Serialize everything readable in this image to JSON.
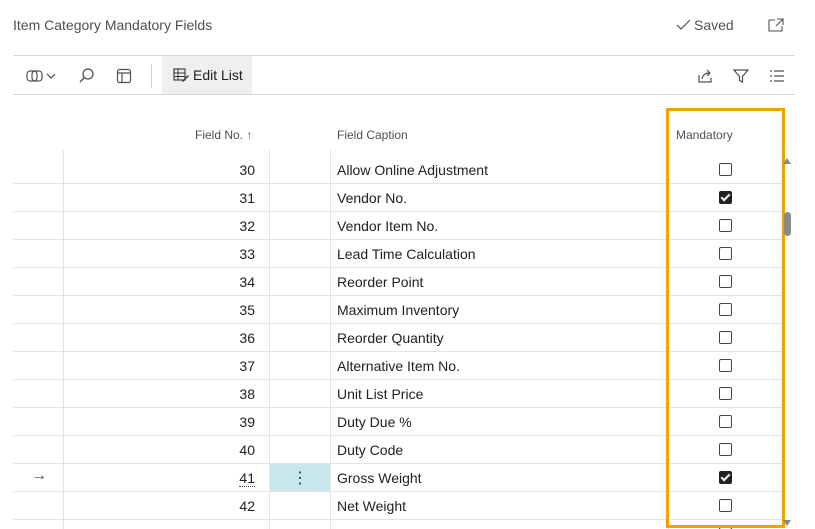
{
  "page": {
    "title": "Item Category Mandatory Fields",
    "saved_label": "Saved"
  },
  "toolbar": {
    "edit_list_label": "Edit List"
  },
  "columns": {
    "field_no": "Field No.",
    "sort_indicator": "↑",
    "field_caption": "Field Caption",
    "mandatory": "Mandatory"
  },
  "rows": [
    {
      "field_no": "30",
      "caption": "Allow Online Adjustment",
      "mandatory": false
    },
    {
      "field_no": "31",
      "caption": "Vendor No.",
      "mandatory": true
    },
    {
      "field_no": "32",
      "caption": "Vendor Item No.",
      "mandatory": false
    },
    {
      "field_no": "33",
      "caption": "Lead Time Calculation",
      "mandatory": false
    },
    {
      "field_no": "34",
      "caption": "Reorder Point",
      "mandatory": false
    },
    {
      "field_no": "35",
      "caption": "Maximum Inventory",
      "mandatory": false
    },
    {
      "field_no": "36",
      "caption": "Reorder Quantity",
      "mandatory": false
    },
    {
      "field_no": "37",
      "caption": "Alternative Item No.",
      "mandatory": false
    },
    {
      "field_no": "38",
      "caption": "Unit List Price",
      "mandatory": false
    },
    {
      "field_no": "39",
      "caption": "Duty Due %",
      "mandatory": false
    },
    {
      "field_no": "40",
      "caption": "Duty Code",
      "mandatory": false
    },
    {
      "field_no": "41",
      "caption": "Gross Weight",
      "mandatory": true,
      "selected": true
    },
    {
      "field_no": "42",
      "caption": "Net Weight",
      "mandatory": false
    }
  ],
  "icons": {
    "saved": "checkmark-icon",
    "popout": "popout-icon",
    "select": "select-mode-icon",
    "search": "search-icon",
    "view": "view-icon",
    "edit_list": "edit-list-icon",
    "share": "share-icon",
    "filter": "filter-icon",
    "list_options": "list-options-icon",
    "row_current": "right-arrow-icon",
    "row_menu": "more-vertical-icon"
  },
  "colors": {
    "highlight": "#f0a300",
    "selected_cell": "#c8e6ee",
    "accent": "#212121"
  }
}
